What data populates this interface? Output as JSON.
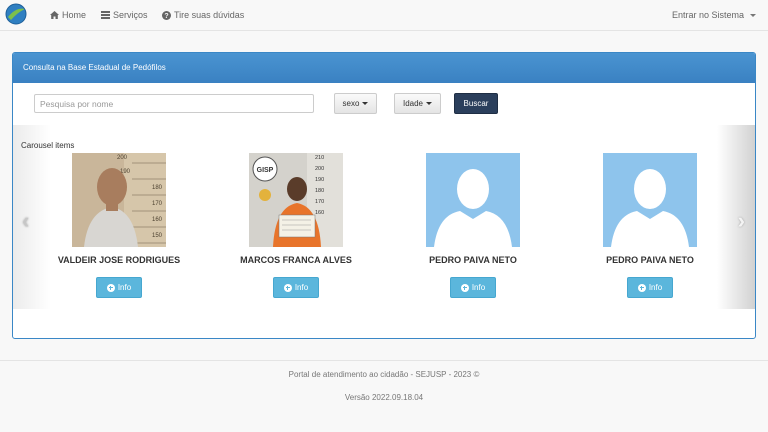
{
  "nav": {
    "home": "Home",
    "servicos": "Serviços",
    "duvidas": "Tire suas dúvidas",
    "login": "Entrar no Sistema"
  },
  "panel": {
    "title": "Consulta na Base Estadual de Pedófilos",
    "search_placeholder": "Pesquisa por nome",
    "sexo_label": "sexo",
    "idade_label": "Idade",
    "buscar_label": "Buscar",
    "carousel_label": "Carousel items"
  },
  "cards": [
    {
      "name": "VALDEIR JOSE RODRIGUES",
      "info_label": "Info",
      "photo": "mugshot"
    },
    {
      "name": "MARCOS FRANCA ALVES",
      "info_label": "Info",
      "photo": "mugshot-gisp"
    },
    {
      "name": "PEDRO PAIVA NETO",
      "info_label": "Info",
      "photo": "placeholder-avatar"
    },
    {
      "name": "PEDRO PAIVA NETO",
      "info_label": "Info",
      "photo": "placeholder-avatar"
    }
  ],
  "footer": {
    "line1": "Portal de atendimento ao cidadão - SEJUSP - 2023 ©",
    "line2": "Versão 2022.09.18.04"
  },
  "colors": {
    "panel_header": "#3a87c6",
    "buscar_button": "#2b3f5c",
    "info_button": "#5bb6dc",
    "avatar_bg": "#8ec4ec"
  }
}
